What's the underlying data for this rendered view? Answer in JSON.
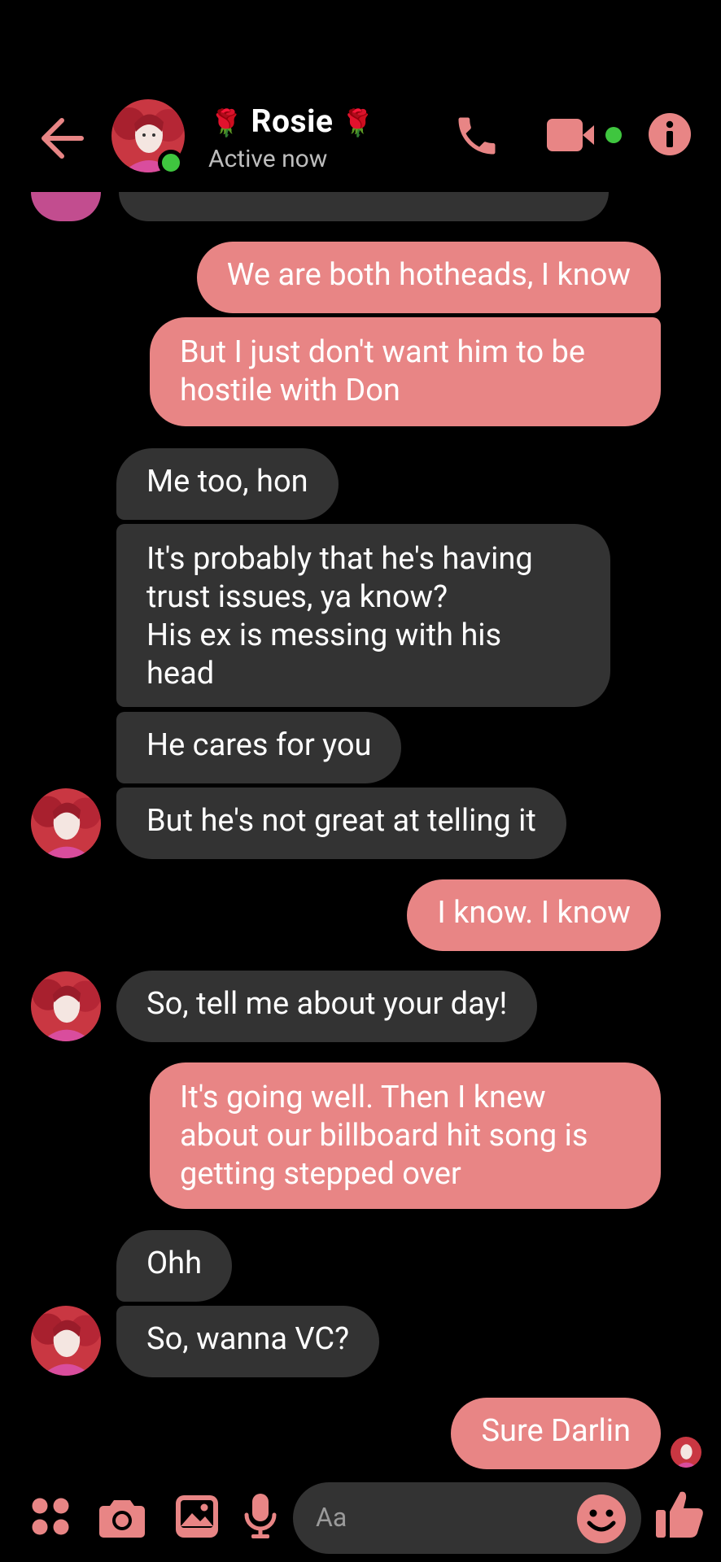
{
  "header": {
    "name_emoji_left": "🌹",
    "name": "Rosie",
    "name_emoji_right": "🌹",
    "status": "Active now"
  },
  "messages": [
    {
      "from": "me",
      "text": "We are both hotheads, I know"
    },
    {
      "from": "me",
      "lines": [
        "But I just don't want him to be",
        "hostile with Don"
      ]
    },
    {
      "from": "them",
      "text": "Me too, hon"
    },
    {
      "from": "them",
      "lines": [
        "It's probably that he's having",
        "trust issues, ya know?",
        "His ex is messing with his",
        "head"
      ]
    },
    {
      "from": "them",
      "text": "He cares for you"
    },
    {
      "from": "them",
      "text": "But he's not great at telling it"
    },
    {
      "from": "me",
      "text": "I know. I know"
    },
    {
      "from": "them",
      "text": "So, tell me about your day!"
    },
    {
      "from": "me",
      "lines": [
        "It's going well. Then I knew",
        "about our billboard hit song is",
        "getting stepped over"
      ]
    },
    {
      "from": "them",
      "text": "Ohh"
    },
    {
      "from": "them",
      "text": "So, wanna VC?"
    },
    {
      "from": "me",
      "text": "Sure Darlin"
    }
  ],
  "composer": {
    "placeholder": "Aa"
  },
  "colors": {
    "accent": "#e88585",
    "incoming_bubble": "#333333",
    "online": "#3fc63f"
  },
  "icons": [
    "back-arrow-icon",
    "phone-icon",
    "video-camera-icon",
    "info-icon",
    "apps-icon",
    "camera-icon",
    "gallery-icon",
    "microphone-icon",
    "emoji-icon",
    "thumbs-up-icon"
  ]
}
